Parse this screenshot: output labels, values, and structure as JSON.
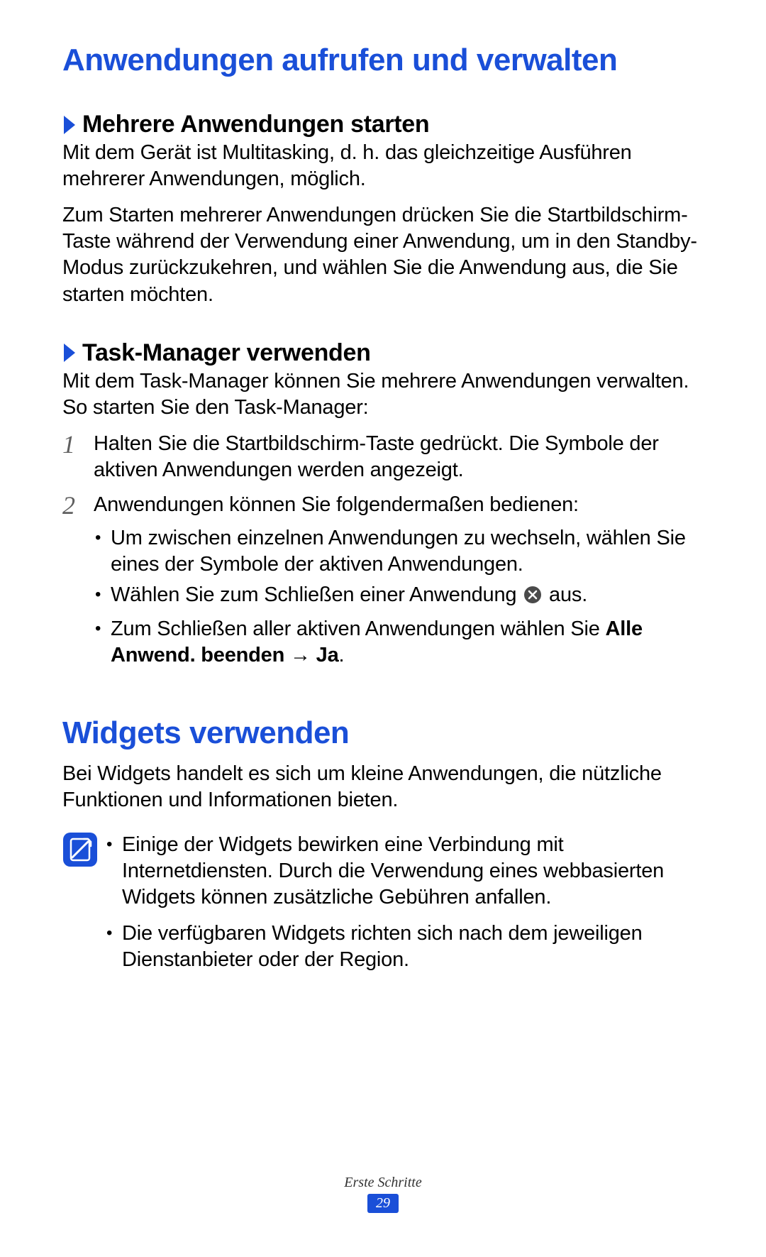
{
  "heading1": "Anwendungen aufrufen und verwalten",
  "section1": {
    "title": "Mehrere Anwendungen starten",
    "p1": "Mit dem Gerät ist Multitasking, d. h. das gleichzeitige Ausführen mehrerer Anwendungen, möglich.",
    "p2": "Zum Starten mehrerer Anwendungen drücken Sie die Startbildschirm-Taste während der Verwendung einer Anwendung, um in den Standby-Modus zurückzukehren, und wählen Sie die Anwendung aus, die Sie starten möchten."
  },
  "section2": {
    "title": "Task-Manager verwenden",
    "p1": "Mit dem Task-Manager können Sie mehrere Anwendungen verwalten. So starten Sie den Task-Manager:",
    "step1": "Halten Sie die Startbildschirm-Taste gedrückt. Die Symbole der aktiven Anwendungen werden angezeigt.",
    "step2_intro": "Anwendungen können Sie folgendermaßen bedienen:",
    "step2_b1": "Um zwischen einzelnen Anwendungen zu wechseln, wählen Sie eines der Symbole der aktiven Anwendungen.",
    "step2_b2_a": "Wählen Sie zum Schließen einer Anwendung ",
    "step2_b2_b": " aus.",
    "step2_b3_a": "Zum Schließen aller aktiven Anwendungen wählen Sie ",
    "step2_b3_bold": "Alle Anwend. beenden → Ja",
    "step2_b3_b": "."
  },
  "heading2": "Widgets verwenden",
  "widgets_p1": "Bei Widgets handelt es sich um kleine Anwendungen, die nützliche Funktionen und Informationen bieten.",
  "note_b1": "Einige der Widgets bewirken eine Verbindung mit Internetdiensten. Durch die Verwendung eines webbasierten Widgets können zusätzliche Gebühren anfallen.",
  "note_b2": "Die verfügbaren Widgets richten sich nach dem jeweiligen Dienstanbieter oder der Region.",
  "footer_label": "Erste Schritte",
  "page_number": "29",
  "nums": {
    "one": "1",
    "two": "2"
  }
}
